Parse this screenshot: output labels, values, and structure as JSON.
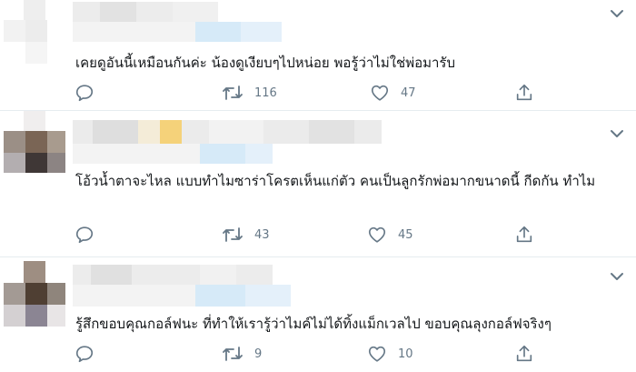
{
  "colors": {
    "icon": "#657786",
    "divider": "#e6ecf0",
    "text": "#14171a",
    "blur_blue": "#d6eaf8",
    "blur_gray": "#e8e8e8",
    "blur_yellow": "#f5d27a"
  },
  "tweets": [
    {
      "text": "เคยดูอันนี้เหมือนกันค่ะ น้องดูเงียบๆไปหน่อย พอรู้ว่าไม่ใช่พ่อมารับ",
      "retweets": "116",
      "likes": "47"
    },
    {
      "text": "โอ้วน้ำตาจะไหล แบบทำไมซาร่าโครตเห็นแก่ตัว คนเป็นลูกรักพ่อมากขนาดนี้ กีดกัน ทำไม",
      "retweets": "43",
      "likes": "45"
    },
    {
      "text": "รู้สึกขอบคุณกอล์ฟนะ ที่ทำให้เรารู้ว่าไมค์ไม่ได้ทิ้งแม็กเวลไป ขอบคุณลุงกอล์ฟจริงๆ",
      "retweets": "9",
      "likes": "10"
    }
  ],
  "icons": {
    "reply": "reply-icon",
    "retweet": "retweet-icon",
    "like": "like-icon",
    "share": "share-icon",
    "more": "chevron-down-icon"
  }
}
